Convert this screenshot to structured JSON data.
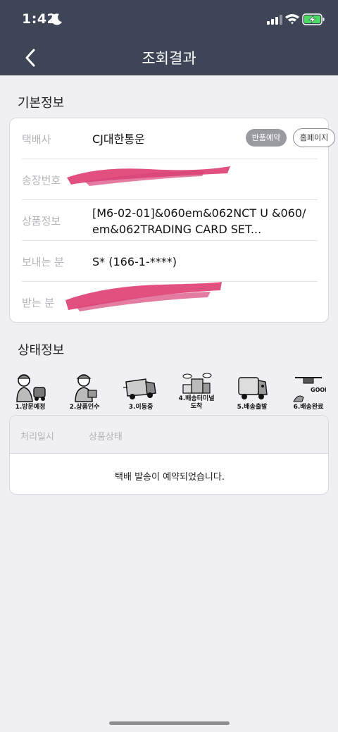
{
  "status_bar": {
    "time": "1:42"
  },
  "header": {
    "title": "조회결과"
  },
  "basic_info": {
    "title": "기본정보",
    "rows": [
      {
        "label": "택배사",
        "value": "CJ대한통운"
      },
      {
        "label": "송장번호",
        "value": ""
      },
      {
        "label": "상품정보",
        "value": "[M6-02-01]&060em&062NCT U &060/ em&062TRADING CARD SET..."
      },
      {
        "label": "보내는 분",
        "value": "S* (166-1-****)"
      },
      {
        "label": "받는 분",
        "value": ""
      }
    ],
    "return_button": "반품예약",
    "homepage_button": "홈페이지"
  },
  "status_info": {
    "title": "상태정보",
    "steps": [
      {
        "label": "1.방문예정",
        "icon": "courier-visit-icon"
      },
      {
        "label": "2.상품인수",
        "icon": "courier-pickup-icon"
      },
      {
        "label": "3.이동중",
        "icon": "truck-moving-icon"
      },
      {
        "label": "4.배송터미널 도착",
        "icon": "terminal-building-icon"
      },
      {
        "label": "5.배송출발",
        "icon": "delivery-truck-icon"
      },
      {
        "label": "6.배송완료",
        "icon": "drone-good-icon"
      }
    ],
    "columns": {
      "time": "처리일시",
      "state": "상품상태"
    },
    "message": "택배 발송이 예약되었습니다."
  },
  "colors": {
    "header": "#3d4556",
    "background": "#efeff4",
    "redaction": "#e2507f"
  }
}
